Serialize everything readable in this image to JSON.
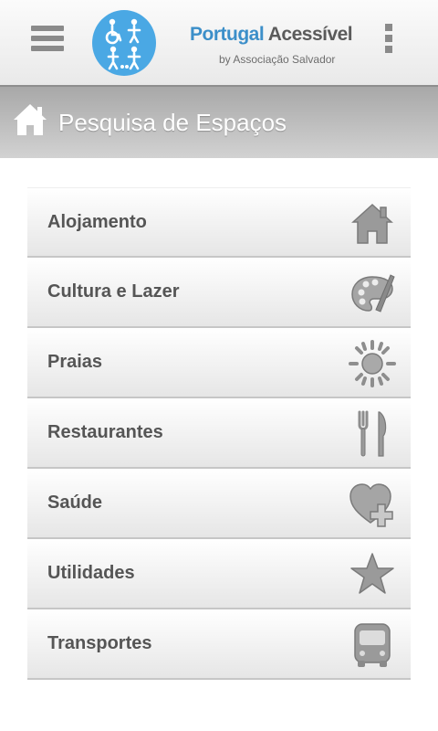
{
  "header": {
    "brand_part1": "Portugal ",
    "brand_part2": "Acessível",
    "brand_subtitle": "by Associação Salvador",
    "menu_icon": "hamburger-menu-icon",
    "overflow_icon": "vertical-dots-icon"
  },
  "titlebar": {
    "title": "Pesquisa de Espaços",
    "icon": "home-icon"
  },
  "categories": [
    {
      "label": "Alojamento",
      "icon": "house-icon"
    },
    {
      "label": "Cultura e Lazer",
      "icon": "palette-icon"
    },
    {
      "label": "Praias",
      "icon": "sun-icon"
    },
    {
      "label": "Restaurantes",
      "icon": "fork-knife-icon"
    },
    {
      "label": "Saúde",
      "icon": "heart-plus-icon"
    },
    {
      "label": "Utilidades",
      "icon": "star-icon"
    },
    {
      "label": "Transportes",
      "icon": "bus-icon"
    }
  ],
  "colors": {
    "brand_blue": "#3c8fc9",
    "logo_circle": "#4aa8e4",
    "label_gray": "#555555",
    "icon_gray": "#8e8e8e"
  }
}
